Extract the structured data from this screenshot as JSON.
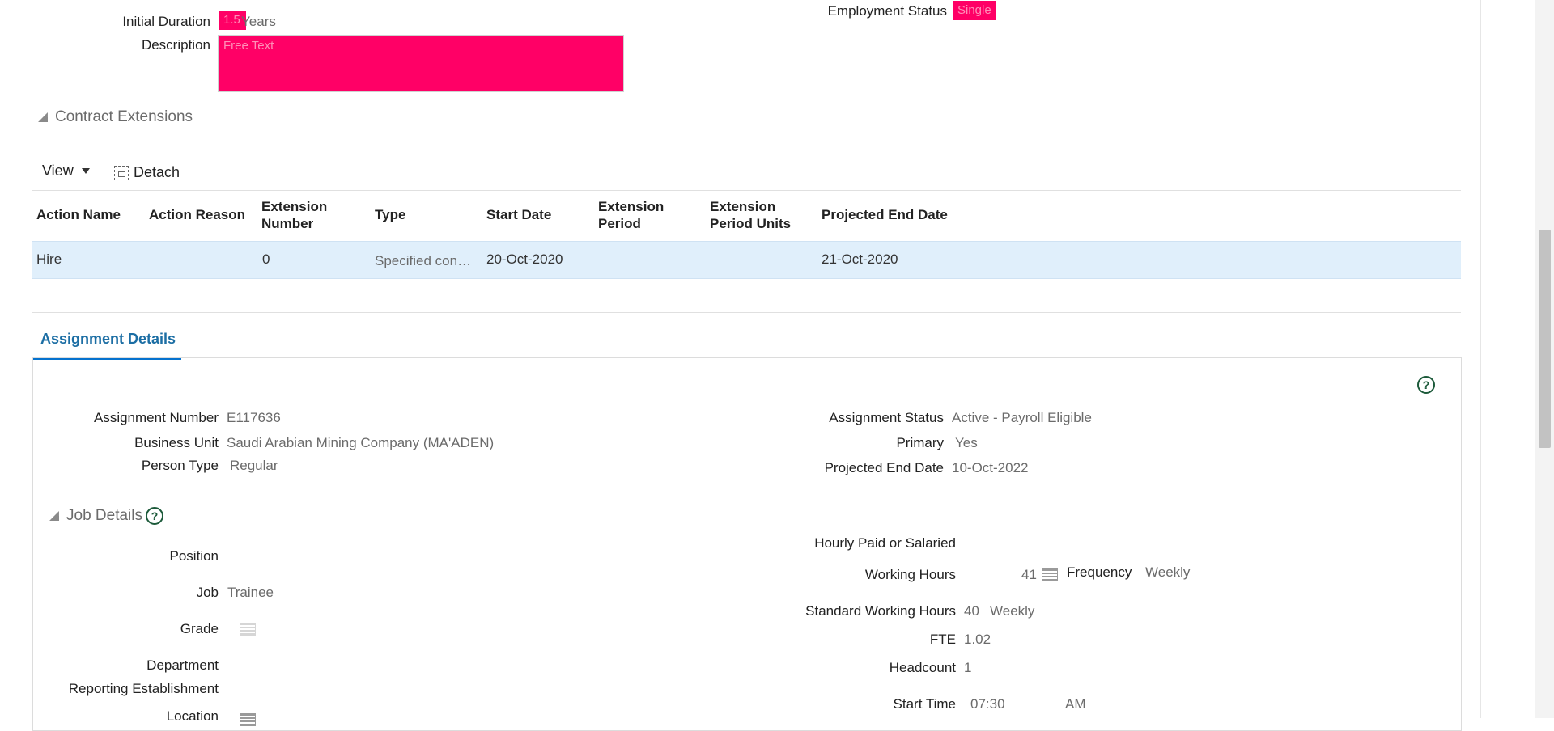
{
  "contract": {
    "initial_duration_label": "Initial Duration",
    "initial_duration_value": "1.5",
    "initial_duration_unit": "Years",
    "description_label": "Description",
    "description_placeholder": "Free Text",
    "employment_status_label": "Employment Status",
    "employment_status_value": "Single"
  },
  "contract_extensions": {
    "title": "Contract Extensions",
    "toolbar": {
      "view_label": "View",
      "detach_label": "Detach"
    },
    "columns": [
      "Action Name",
      "Action Reason",
      "Extension Number",
      "Type",
      "Start Date",
      "Extension Period",
      "Extension Period Units",
      "Projected End Date"
    ],
    "column_lines": [
      [
        "Action Name"
      ],
      [
        "Action Reason"
      ],
      [
        "Extension",
        "Number"
      ],
      [
        "Type"
      ],
      [
        "Start Date"
      ],
      [
        "Extension",
        "Period"
      ],
      [
        "Extension",
        "Period Units"
      ],
      [
        "Projected End Date"
      ]
    ],
    "rows": [
      {
        "action_name": "Hire",
        "action_reason": "",
        "extension_number": "0",
        "type": "Specified con…",
        "start_date": "20-Oct-2020",
        "extension_period": "",
        "extension_period_units": "",
        "projected_end_date": "21-Oct-2020"
      }
    ]
  },
  "assignment": {
    "tab_label": "Assignment Details",
    "help_icon": "question-circle-icon",
    "assignment_number_label": "Assignment Number",
    "assignment_number": "E117636",
    "business_unit_label": "Business Unit",
    "business_unit": "Saudi Arabian Mining Company (MA'ADEN)",
    "person_type_label": "Person Type",
    "person_type": "Regular",
    "assignment_status_label": "Assignment Status",
    "assignment_status": "Active - Payroll Eligible",
    "primary_label": "Primary",
    "primary": "Yes",
    "projected_end_date_label": "Projected End Date",
    "projected_end_date": "10-Oct-2022"
  },
  "job_details": {
    "title": "Job Details",
    "position_label": "Position",
    "job_label": "Job",
    "job": "Trainee",
    "grade_label": "Grade",
    "department_label": "Department",
    "reporting_establishment_label": "Reporting Establishment",
    "location_label": "Location",
    "hourly_paid_label": "Hourly Paid or Salaried",
    "working_hours_label": "Working Hours",
    "working_hours": "41",
    "frequency_label": "Frequency",
    "frequency": "Weekly",
    "standard_working_hours_label": "Standard Working Hours",
    "standard_working_hours": "40",
    "standard_working_hours_freq": "Weekly",
    "fte_label": "FTE",
    "fte": "1.02",
    "headcount_label": "Headcount",
    "headcount": "1",
    "start_time_label": "Start Time",
    "start_time": "07:30",
    "start_time_ampm": "AM"
  },
  "colors": {
    "highlight": "#ff0066",
    "accent": "#0572ce",
    "selected_row": "#e0effb"
  }
}
